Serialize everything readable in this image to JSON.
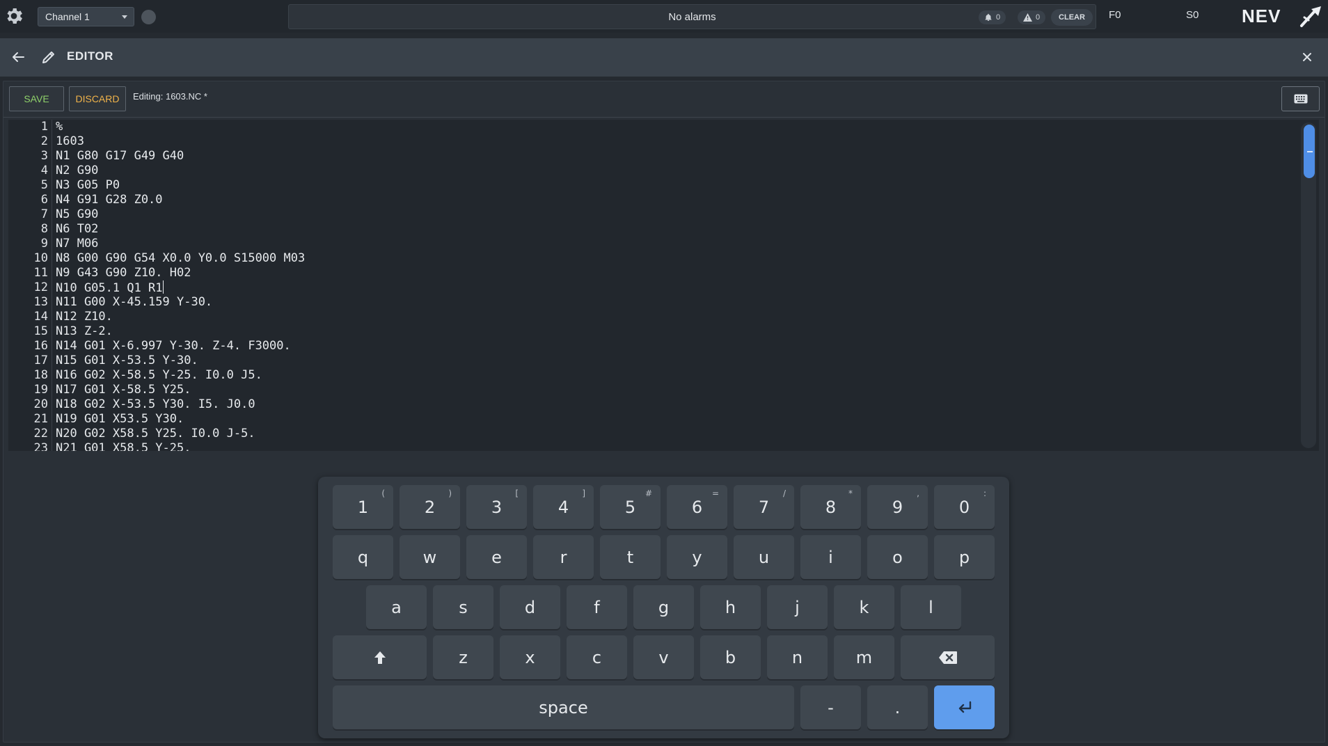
{
  "topbar": {
    "channel": "Channel 1",
    "alarm_text": "No alarms",
    "notifications_count": "0",
    "warnings_count": "0",
    "clear_label": "CLEAR",
    "feed": "F0",
    "spindle": "S0",
    "brand": "NEV"
  },
  "editor": {
    "title": "EDITOR",
    "save_label": "SAVE",
    "discard_label": "DISCARD",
    "editing": "Editing: 1603.NC *",
    "lines": [
      {
        "no": "1",
        "text": "%"
      },
      {
        "no": "2",
        "text": "1603"
      },
      {
        "no": "3",
        "text": "N1 G80 G17 G49 G40"
      },
      {
        "no": "4",
        "text": "N2 G90"
      },
      {
        "no": "5",
        "text": "N3 G05 P0"
      },
      {
        "no": "6",
        "text": "N4 G91 G28 Z0.0"
      },
      {
        "no": "7",
        "text": "N5 G90"
      },
      {
        "no": "8",
        "text": "N6 T02"
      },
      {
        "no": "9",
        "text": "N7 M06"
      },
      {
        "no": "10",
        "text": "N8 G00 G90 G54 X0.0 Y0.0 S15000 M03"
      },
      {
        "no": "11",
        "text": "N9 G43 G90 Z10. H02"
      },
      {
        "no": "12",
        "text": "N10 G05.1 Q1 R1"
      },
      {
        "no": "13",
        "text": "N11 G00 X-45.159 Y-30."
      },
      {
        "no": "14",
        "text": "N12 Z10."
      },
      {
        "no": "15",
        "text": "N13 Z-2."
      },
      {
        "no": "16",
        "text": "N14 G01 X-6.997 Y-30. Z-4. F3000."
      },
      {
        "no": "17",
        "text": "N15 G01 X-53.5 Y-30."
      },
      {
        "no": "18",
        "text": "N16 G02 X-58.5 Y-25. I0.0 J5."
      },
      {
        "no": "19",
        "text": "N17 G01 X-58.5 Y25."
      },
      {
        "no": "20",
        "text": "N18 G02 X-53.5 Y30. I5. J0.0"
      },
      {
        "no": "21",
        "text": "N19 G01 X53.5 Y30."
      },
      {
        "no": "22",
        "text": "N20 G02 X58.5 Y25. I0.0 J-5."
      },
      {
        "no": "23",
        "text": "N21 G01 X58.5 Y-25."
      }
    ],
    "scroll_fraction": 0.0
  },
  "keyboard": {
    "number_row": [
      {
        "key": "1",
        "alt": "("
      },
      {
        "key": "2",
        "alt": ")"
      },
      {
        "key": "3",
        "alt": "["
      },
      {
        "key": "4",
        "alt": "]"
      },
      {
        "key": "5",
        "alt": "#"
      },
      {
        "key": "6",
        "alt": "="
      },
      {
        "key": "7",
        "alt": "/"
      },
      {
        "key": "8",
        "alt": "*"
      },
      {
        "key": "9",
        "alt": ","
      },
      {
        "key": "0",
        "alt": ":"
      }
    ],
    "row_q": [
      "q",
      "w",
      "e",
      "r",
      "t",
      "y",
      "u",
      "i",
      "o",
      "p"
    ],
    "row_a": [
      "a",
      "s",
      "d",
      "f",
      "g",
      "h",
      "j",
      "k",
      "l"
    ],
    "row_z": [
      "z",
      "x",
      "c",
      "v",
      "b",
      "n",
      "m"
    ],
    "space_label": "space",
    "minus_label": "-",
    "dot_label": ".",
    "enter_color": "#5f9ded"
  },
  "colors": {
    "save": "#8fd16a",
    "discard": "#f0b34a",
    "scroll_thumb": "#4f8ee6"
  },
  "icons": [
    "gear-icon",
    "back-arrow-icon",
    "pencil-icon",
    "close-icon",
    "bell-icon",
    "warning-icon",
    "keyboard-icon",
    "shift-icon",
    "backspace-icon",
    "enter-icon"
  ]
}
